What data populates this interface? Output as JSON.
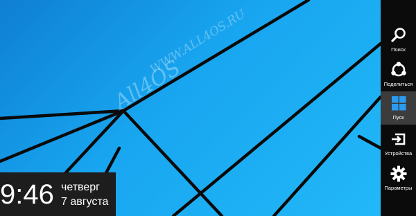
{
  "watermark": {
    "main": "All4OS",
    "small": "WWW.ALL4OS.RU"
  },
  "clock": {
    "time": "9:46",
    "day": "четверг",
    "date": "7 августа"
  },
  "charms": [
    {
      "label": "Поиск",
      "icon": "search-icon"
    },
    {
      "label": "Поделиться",
      "icon": "share-icon"
    },
    {
      "label": "Пуск",
      "icon": "windows-logo-icon",
      "active": true
    },
    {
      "label": "Устройства",
      "icon": "devices-icon"
    },
    {
      "label": "Параметры",
      "icon": "gear-icon"
    }
  ],
  "colors": {
    "desktop": "#1e9ae6",
    "charms_bg": "#0b0b0b",
    "charm_active": "#3c3c3c",
    "clock_bg": "#1d1d1d",
    "windows_logo": "#2a9bf0"
  }
}
